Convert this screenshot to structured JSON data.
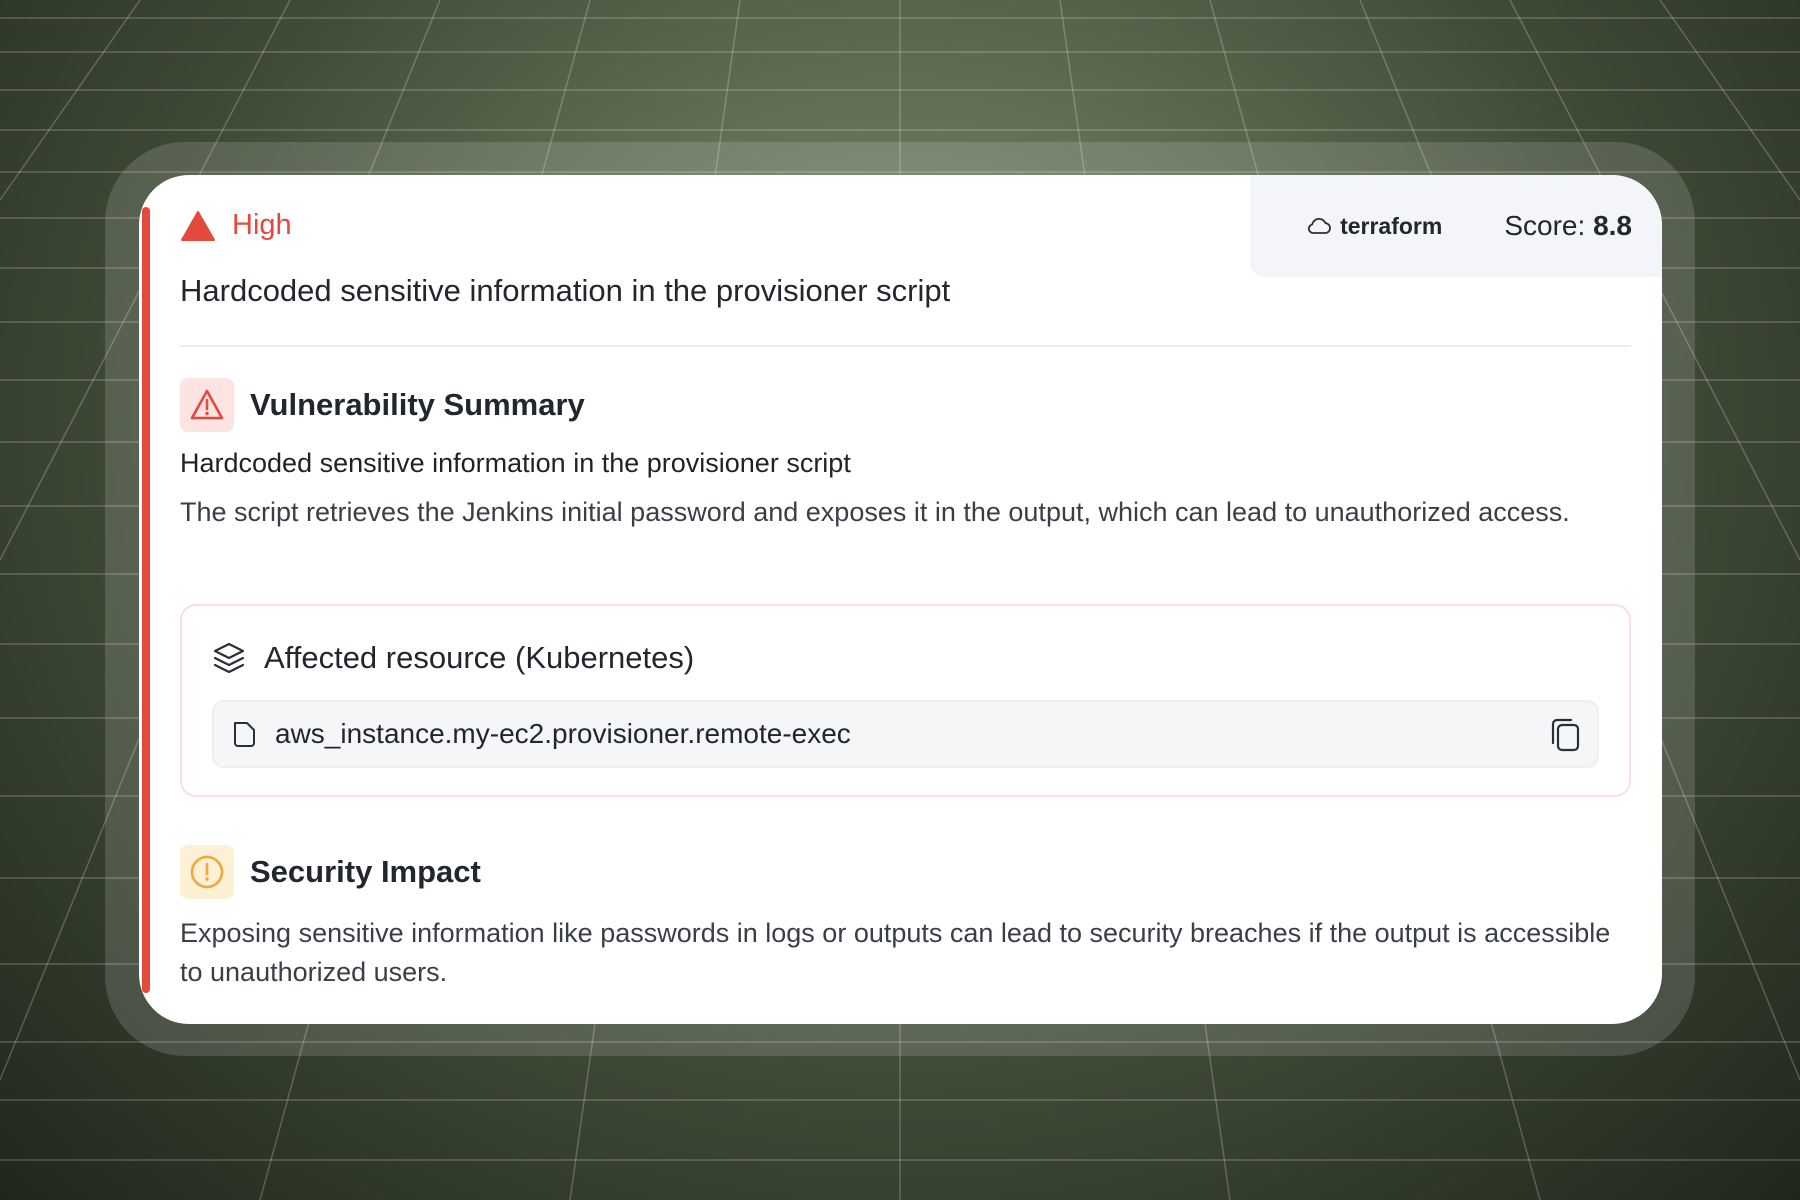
{
  "severity": {
    "label": "High",
    "icon": "triangle-alert-icon",
    "color": "#e5483d"
  },
  "finding": {
    "title": "Hardcoded sensitive information in the provisioner script"
  },
  "meta": {
    "tool_icon": "cloud-icon",
    "tool": "terraform",
    "score_label": "Score:",
    "score_value": "8.8"
  },
  "summary": {
    "icon": "warning-triangle-icon",
    "title": "Vulnerability Summary",
    "subtitle": "Hardcoded sensitive information in the provisioner script",
    "description": "The script retrieves the Jenkins initial password and exposes it in the output, which can lead to unauthorized access."
  },
  "resource": {
    "icon": "layers-icon",
    "title": "Affected resource (Kubernetes)",
    "path_icon": "file-icon",
    "path": "aws_instance.my-ec2.provisioner.remote-exec",
    "copy_icon": "copy-icon"
  },
  "impact": {
    "icon": "info-circle-icon",
    "title": "Security Impact",
    "description": "Exposing sensitive information like passwords in logs or outputs can lead to security breaches if the output is accessible to unauthorized users."
  },
  "colors": {
    "accent": "#e5483d",
    "warning": "#f0a83a",
    "background": "#5f6e54"
  }
}
